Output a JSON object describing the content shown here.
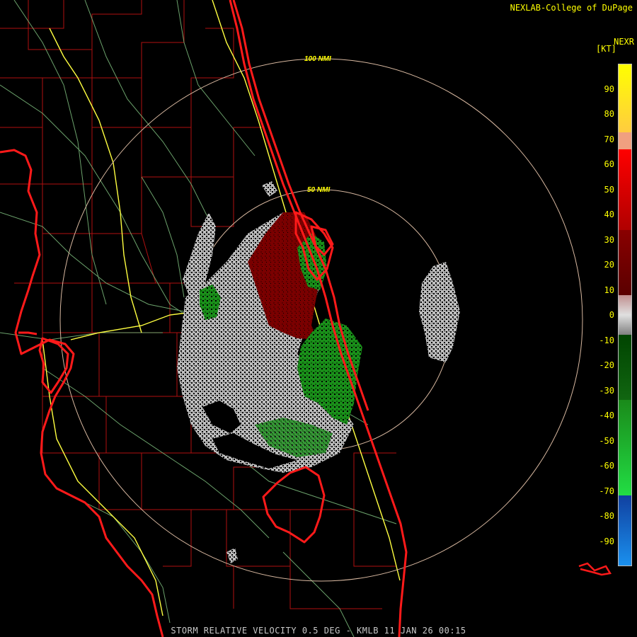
{
  "header": {
    "credit": "NEXLAB-College of DuPage",
    "product": "NEXR",
    "units": "[KT]"
  },
  "footer": {
    "caption": "STORM RELATIVE VELOCITY 0.5 DEG - KMLB 11 JAN 26 00:15"
  },
  "range_rings": [
    {
      "label": "100 NMI"
    },
    {
      "label": "50 NMI"
    }
  ],
  "legend": {
    "ticks": [
      "90",
      "80",
      "70",
      "60",
      "50",
      "40",
      "30",
      "20",
      "10",
      "0",
      "-10",
      "-20",
      "-30",
      "-40",
      "-50",
      "-60",
      "-70",
      "-80",
      "-90"
    ],
    "min": -100,
    "max": 100
  },
  "colors": {
    "background": "#000000",
    "text": "#ffff00",
    "coastline": "#ff1a1a",
    "county_lines": "#b01010",
    "roads": "#ffff40",
    "rivers": "#7fbf7f",
    "range_ring": "#d8b8a0",
    "inbound_green": "#1e9e1e",
    "outbound_red": "#7a0000",
    "near_zero_gray": "#c8c8c8"
  },
  "radar": {
    "site": "KMLB",
    "product": "STORM RELATIVE VELOCITY",
    "elevation_deg": 0.5
  }
}
